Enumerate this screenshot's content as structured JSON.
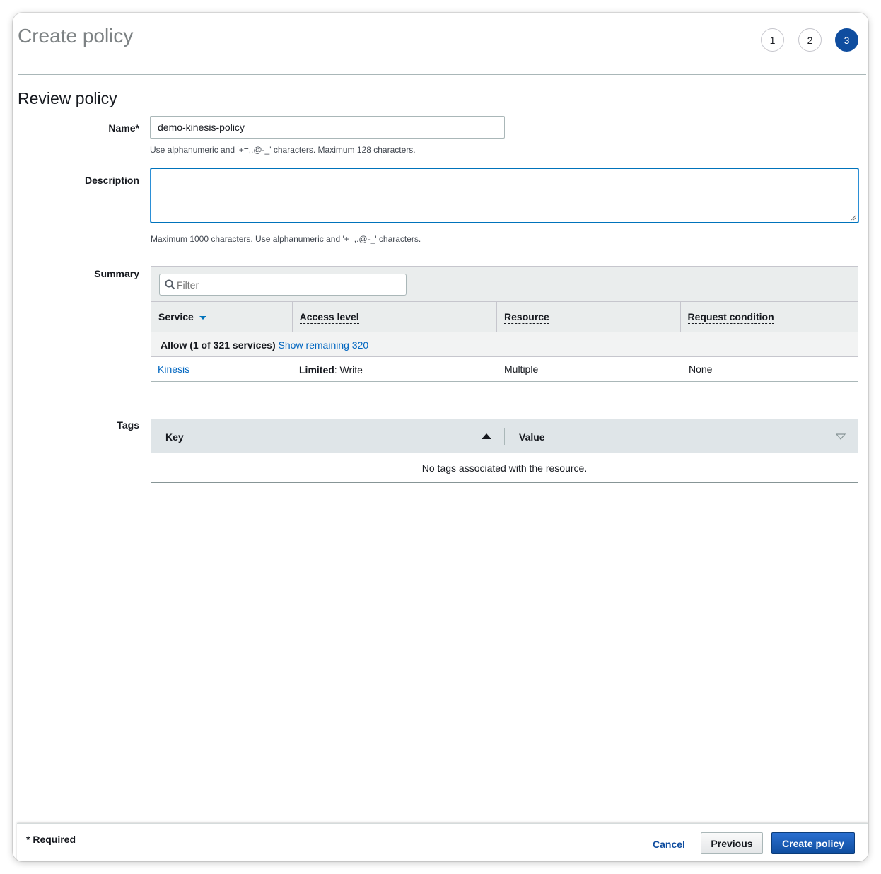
{
  "page": {
    "title": "Create policy",
    "section_title": "Review policy"
  },
  "steps": [
    "1",
    "2",
    "3"
  ],
  "active_step": "3",
  "form": {
    "name_label": "Name*",
    "name_value": "demo-kinesis-policy",
    "name_hint": "Use alphanumeric and '+=,.@-_' characters. Maximum 128 characters.",
    "description_label": "Description",
    "description_value": "",
    "description_hint": "Maximum 1000 characters. Use alphanumeric and '+=,.@-_' characters."
  },
  "summary": {
    "label": "Summary",
    "filter_placeholder": "Filter",
    "columns": [
      "Service",
      "Access level",
      "Resource",
      "Request condition"
    ],
    "allow_text": "Allow (1 of 321 services)",
    "show_remaining": "Show remaining 320",
    "rows": [
      {
        "service": "Kinesis",
        "access_level_bold": "Limited",
        "access_level_rest": ": Write",
        "resource": "Multiple",
        "request_condition": "None"
      }
    ]
  },
  "tags": {
    "label": "Tags",
    "key_header": "Key",
    "value_header": "Value",
    "empty_text": "No tags associated with the resource."
  },
  "footer": {
    "required_note": "* Required",
    "cancel": "Cancel",
    "previous": "Previous",
    "create": "Create policy"
  },
  "colors": {
    "primary": "#0f4d9f",
    "link": "#0066c0",
    "focus": "#0073bb"
  }
}
